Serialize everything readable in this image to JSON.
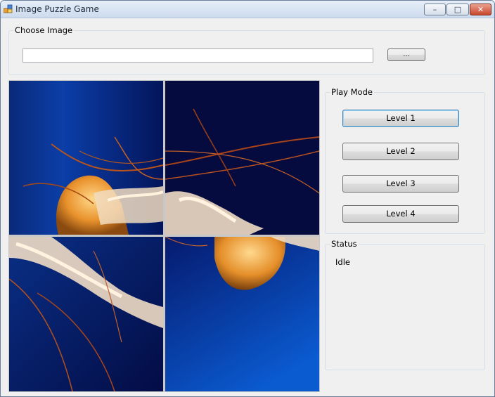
{
  "window": {
    "title": "Image Puzzle Game",
    "minimize_glyph": "–",
    "maximize_glyph": "□",
    "close_glyph": "✕"
  },
  "choose_image": {
    "group_label": "Choose Image",
    "path_value": "",
    "browse_label": "..."
  },
  "play_mode": {
    "group_label": "Play Mode",
    "levels": [
      "Level 1",
      "Level 2",
      "Level 3",
      "Level 4"
    ],
    "focused_level": "Level 1"
  },
  "status": {
    "group_label": "Status",
    "text": "Idle"
  },
  "puzzle": {
    "grid": "2x2",
    "image_subject": "orange jellyfish on blue background",
    "tiles": [
      "tile-1",
      "tile-2",
      "tile-3",
      "tile-4"
    ]
  }
}
